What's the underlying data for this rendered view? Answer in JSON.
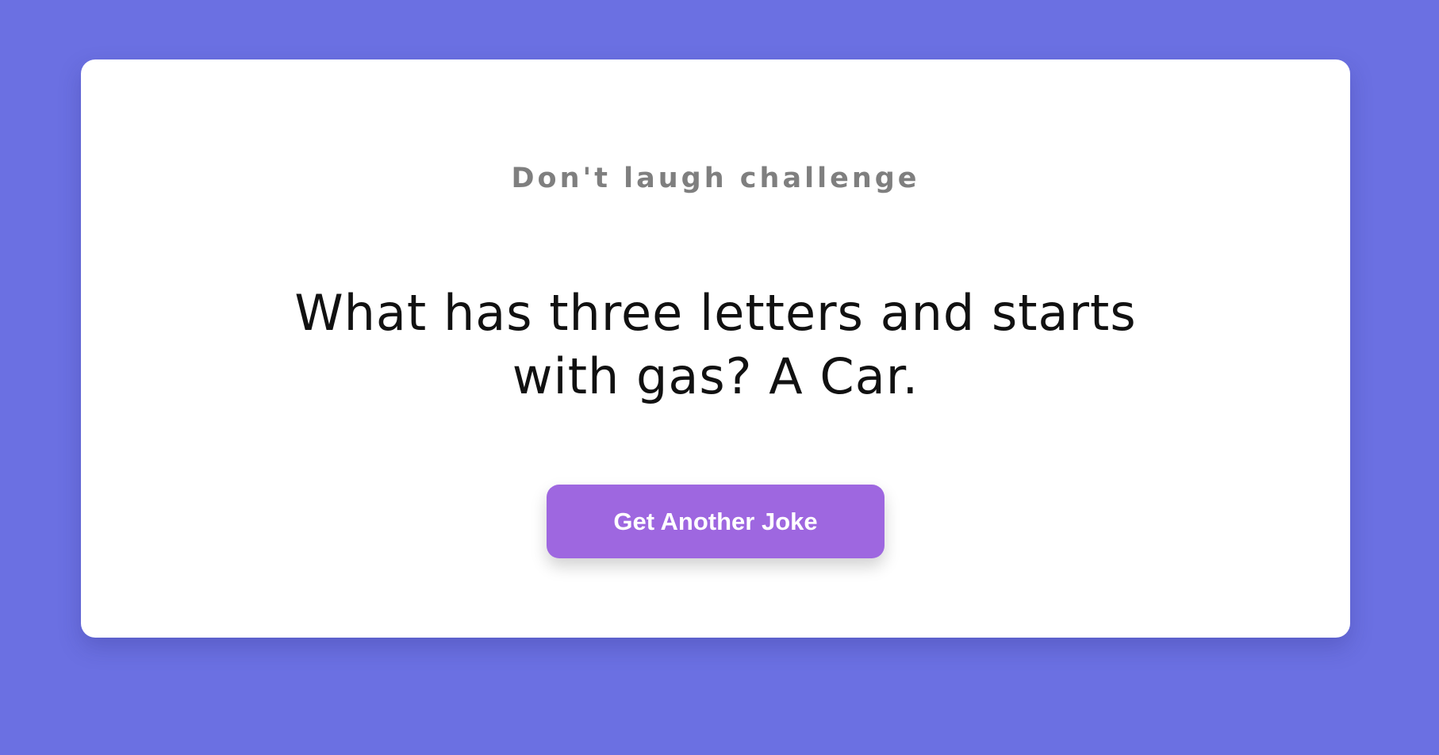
{
  "card": {
    "header": "Don't laugh challenge",
    "joke": "What has three letters and starts with gas? A Car.",
    "button_label": "Get Another Joke"
  },
  "colors": {
    "background": "#6b70e2",
    "card": "#ffffff",
    "button": "#9e67e0",
    "header_text": "#7f7f7f",
    "joke_text": "#111111"
  }
}
